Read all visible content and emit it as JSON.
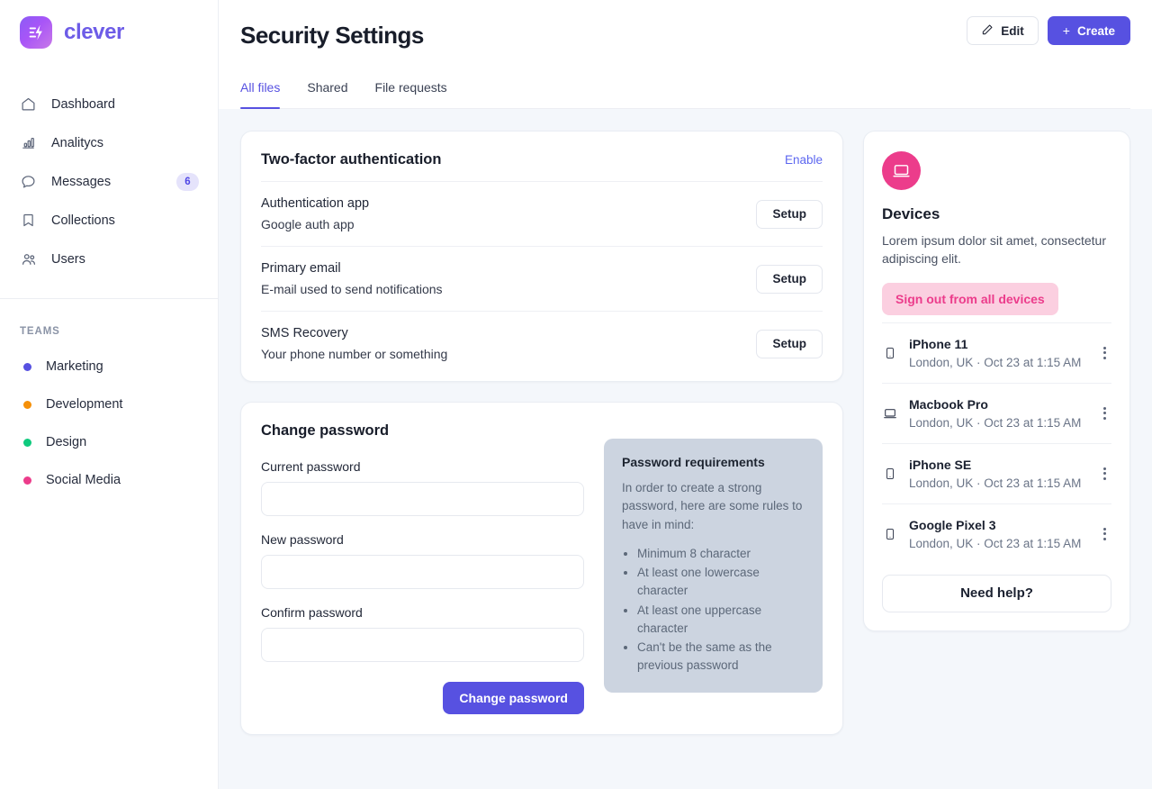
{
  "brand": {
    "name": "clever",
    "logo_icon": "lightning-logo-icon",
    "accent": "#6d5ce7"
  },
  "sidebar": {
    "items": [
      {
        "label": "Dashboard",
        "icon": "home-icon",
        "badge": null
      },
      {
        "label": "Analitycs",
        "icon": "bar-chart-icon",
        "badge": null
      },
      {
        "label": "Messages",
        "icon": "chat-bubble-icon",
        "badge": "6"
      },
      {
        "label": "Collections",
        "icon": "bookmark-icon",
        "badge": null
      },
      {
        "label": "Users",
        "icon": "users-icon",
        "badge": null
      }
    ],
    "teams_heading": "TEAMS",
    "teams": [
      {
        "label": "Marketing",
        "color": "#5751e1"
      },
      {
        "label": "Development",
        "color": "#f59009"
      },
      {
        "label": "Design",
        "color": "#0fca7e"
      },
      {
        "label": "Social Media",
        "color": "#ec3c8b"
      }
    ]
  },
  "header": {
    "title": "Security Settings",
    "edit_label": "Edit",
    "edit_icon": "pencil-icon",
    "create_label": "Create",
    "create_icon": "plus-icon",
    "tabs": [
      {
        "label": "All files",
        "active": true
      },
      {
        "label": "Shared",
        "active": false
      },
      {
        "label": "File requests",
        "active": false
      }
    ]
  },
  "two_factor": {
    "title": "Two-factor authentication",
    "enable_label": "Enable",
    "rows": [
      {
        "title": "Authentication app",
        "subtitle": "Google auth app",
        "button": "Setup"
      },
      {
        "title": "Primary email",
        "subtitle": "E-mail used to send notifications",
        "button": "Setup"
      },
      {
        "title": "SMS Recovery",
        "subtitle": "Your phone number or something",
        "button": "Setup"
      }
    ]
  },
  "change_password": {
    "title": "Change password",
    "fields": [
      {
        "label": "Current password",
        "value": "",
        "placeholder": ""
      },
      {
        "label": "New password",
        "value": "",
        "placeholder": ""
      },
      {
        "label": "Confirm password",
        "value": "",
        "placeholder": ""
      }
    ],
    "submit_label": "Change password",
    "requirements": {
      "title": "Password requirements",
      "intro": "In order to create a strong password, here are some rules to have in mind:",
      "items": [
        "Minimum 8 character",
        "At least one lowercase character",
        "At least one uppercase character",
        "Can't be the same as the previous password"
      ]
    }
  },
  "devices": {
    "icon": "laptop-icon",
    "icon_color": "#ec3c8b",
    "title": "Devices",
    "description": "Lorem ipsum dolor sit amet, consectetur adipiscing elit.",
    "signout_label": "Sign out from all devices",
    "list": [
      {
        "name": "iPhone 11",
        "meta": "London, UK · Oct 23 at 1:15 AM",
        "icon": "phone-icon"
      },
      {
        "name": "Macbook Pro",
        "meta": "London, UK · Oct 23 at 1:15 AM",
        "icon": "laptop-icon"
      },
      {
        "name": "iPhone SE",
        "meta": "London, UK · Oct 23 at 1:15 AM",
        "icon": "phone-icon"
      },
      {
        "name": "Google Pixel 3",
        "meta": "London, UK · Oct 23 at 1:15 AM",
        "icon": "phone-icon"
      }
    ],
    "help_label": "Need help?"
  }
}
